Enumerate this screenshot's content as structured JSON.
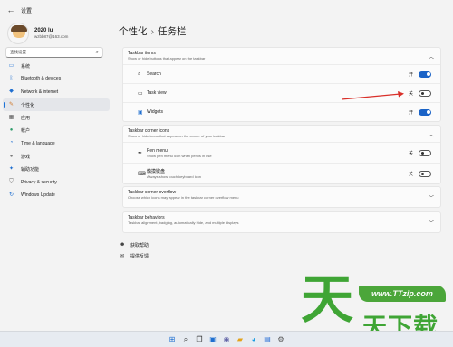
{
  "window": {
    "title": "设置",
    "back_glyph": "←"
  },
  "profile": {
    "name": "2020 lu",
    "email": "wzbb87@163.com"
  },
  "search": {
    "placeholder": "查找设置"
  },
  "sidebar": {
    "items": [
      {
        "label": "系统",
        "icon": "system-icon",
        "active": false
      },
      {
        "label": "Bluetooth & devices",
        "icon": "bluetooth-icon",
        "active": false
      },
      {
        "label": "Network & internet",
        "icon": "wifi-icon",
        "active": false
      },
      {
        "label": "个性化",
        "icon": "brush-icon",
        "active": true
      },
      {
        "label": "应用",
        "icon": "apps-icon",
        "active": false
      },
      {
        "label": "帐户",
        "icon": "account-icon",
        "active": false
      },
      {
        "label": "Time & language",
        "icon": "globe-clock-icon",
        "active": false
      },
      {
        "label": "游戏",
        "icon": "gamepad-icon",
        "active": false
      },
      {
        "label": "辅助功能",
        "icon": "accessibility-icon",
        "active": false
      },
      {
        "label": "Privacy & security",
        "icon": "shield-icon",
        "active": false
      },
      {
        "label": "Windows Update",
        "icon": "update-icon",
        "active": false
      }
    ]
  },
  "breadcrumb": {
    "parent": "个性化",
    "separator": "›",
    "current": "任务栏"
  },
  "taskbar_items": {
    "title": "Taskbar items",
    "desc": "Show or hide buttons that appear on the taskbar",
    "rows": [
      {
        "label": "Search",
        "state": "开",
        "on": true,
        "icon": "search-icon"
      },
      {
        "label": "Task view",
        "state": "关",
        "on": false,
        "icon": "task-view-icon"
      },
      {
        "label": "Widgets",
        "state": "开",
        "on": true,
        "icon": "widgets-icon"
      }
    ]
  },
  "corner_icons": {
    "title": "Taskbar corner icons",
    "desc": "Show or hide icons that appear on the corner of your taskbar",
    "rows": [
      {
        "label": "Pen menu",
        "sub": "Show pen menu icon when pen is in use",
        "state": "关",
        "on": false,
        "icon": "pen-icon"
      },
      {
        "label": "触摸键盘",
        "sub": "Always show touch keyboard icon",
        "state": "关",
        "on": false,
        "icon": "keyboard-icon"
      }
    ]
  },
  "corner_overflow": {
    "title": "Taskbar corner overflow",
    "desc": "Choose which icons may appear in the taskbar corner overflow menu"
  },
  "behaviors": {
    "title": "Taskbar behaviors",
    "desc": "Taskbar alignment, badging, automatically hide, and multiple displays"
  },
  "help_links": {
    "get_help": "获取帮助",
    "feedback": "提供反馈"
  },
  "watermark": {
    "badge": "www.TTzip.com",
    "big": "天",
    "text": "天下载"
  },
  "colors": {
    "accent": "#1a63c7",
    "annotation_arrow": "#d9302a",
    "watermark_green": "#3fa535"
  }
}
